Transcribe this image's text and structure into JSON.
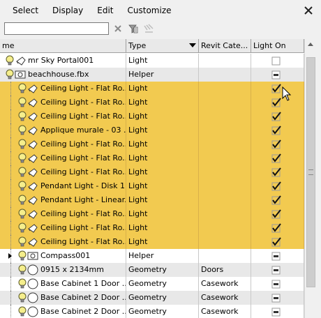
{
  "menu": [
    "Select",
    "Display",
    "Edit",
    "Customize"
  ],
  "search": {
    "value": "",
    "placeholder": ""
  },
  "toolbar_icons": [
    "clear-filter-icon",
    "filter-icon",
    "filter-settings-icon"
  ],
  "columns": {
    "name": "me",
    "type": "Type",
    "revit": "Revit Cate...",
    "light_on": "Light On"
  },
  "rows": [
    {
      "name": "mr Sky Portal001",
      "type": "Light",
      "revit": "",
      "light_on": "unchecked",
      "style": "plain"
    },
    {
      "name": "beachhouse.fbx",
      "type": "Helper",
      "revit": "",
      "light_on": "mixed",
      "style": "alt"
    },
    {
      "name": "Ceiling Light - Flat Ro...",
      "type": "Light",
      "revit": "",
      "light_on": "checked",
      "style": "sel"
    },
    {
      "name": "Ceiling Light - Flat Ro...",
      "type": "Light",
      "revit": "",
      "light_on": "checked",
      "style": "sel"
    },
    {
      "name": "Ceiling Light - Flat Ro...",
      "type": "Light",
      "revit": "",
      "light_on": "checked",
      "style": "sel"
    },
    {
      "name": "Applique murale - 03 ...",
      "type": "Light",
      "revit": "",
      "light_on": "checked",
      "style": "sel"
    },
    {
      "name": "Ceiling Light - Flat Ro...",
      "type": "Light",
      "revit": "",
      "light_on": "checked",
      "style": "sel"
    },
    {
      "name": "Ceiling Light - Flat Ro...",
      "type": "Light",
      "revit": "",
      "light_on": "checked",
      "style": "sel"
    },
    {
      "name": "Ceiling Light - Flat Ro...",
      "type": "Light",
      "revit": "",
      "light_on": "checked",
      "style": "sel"
    },
    {
      "name": "Pendant Light - Disk 1...",
      "type": "Light",
      "revit": "",
      "light_on": "checked",
      "style": "sel"
    },
    {
      "name": "Pendant Light - Linear...",
      "type": "Light",
      "revit": "",
      "light_on": "checked",
      "style": "sel"
    },
    {
      "name": "Ceiling Light - Flat Ro...",
      "type": "Light",
      "revit": "",
      "light_on": "checked",
      "style": "sel"
    },
    {
      "name": "Ceiling Light - Flat Ro...",
      "type": "Light",
      "revit": "",
      "light_on": "checked",
      "style": "sel"
    },
    {
      "name": "Ceiling Light - Flat Ro...",
      "type": "Light",
      "revit": "",
      "light_on": "checked",
      "style": "sel"
    },
    {
      "name": "Compass001",
      "type": "Helper",
      "revit": "",
      "light_on": "mixed",
      "style": "plain"
    },
    {
      "name": "0915 x 2134mm",
      "type": "Geometry",
      "revit": "Doors",
      "light_on": "mixed",
      "style": "alt"
    },
    {
      "name": "Base Cabinet 1 Door ...",
      "type": "Geometry",
      "revit": "Casework",
      "light_on": "mixed",
      "style": "plain"
    },
    {
      "name": "Base Cabinet 2 Door ...",
      "type": "Geometry",
      "revit": "Casework",
      "light_on": "mixed",
      "style": "alt"
    },
    {
      "name": "Base Cabinet 2 Door ...",
      "type": "Geometry",
      "revit": "Casework",
      "light_on": "mixed",
      "style": "plain"
    }
  ]
}
